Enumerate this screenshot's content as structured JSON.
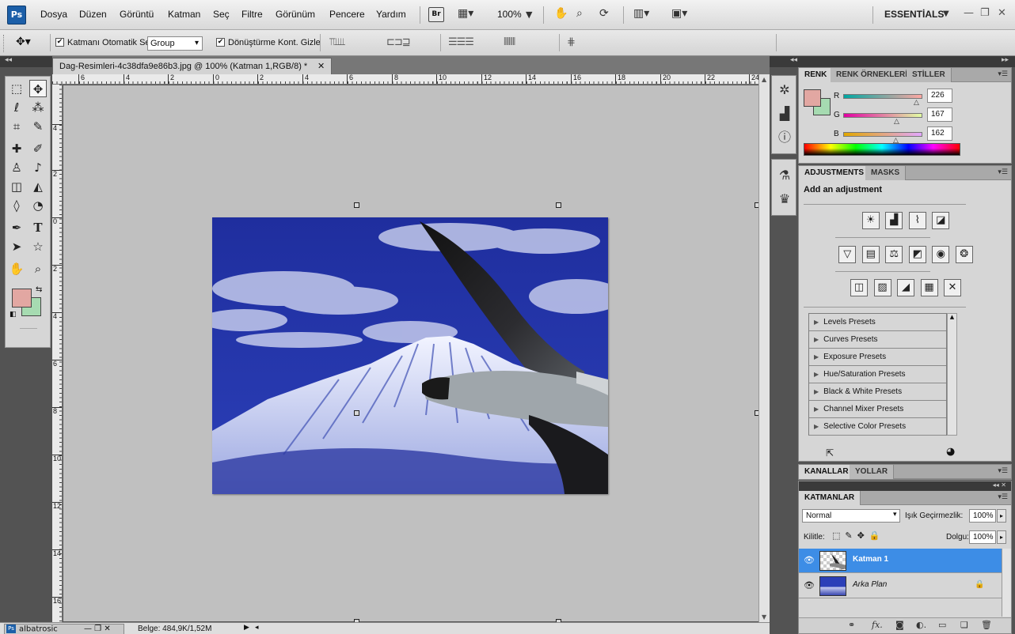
{
  "app": {
    "logo": "Ps",
    "workspace": "ESSENTİALS",
    "bridge": "Br",
    "zoom": "100%"
  },
  "menu": [
    "Dosya",
    "Düzen",
    "Görüntü",
    "Katman",
    "Seç",
    "Filtre",
    "Görünüm",
    "Pencere",
    "Yardım"
  ],
  "options": {
    "auto_select_label": "Katmanı Otomatik Seç",
    "auto_select_value": "Group",
    "transform_label": "Dönüştürme Kont. Gizle"
  },
  "document": {
    "tab_title": "Dag-Resimleri-4c38dfa9e86b3.jpg @ 100% (Katman 1,RGB/8) *",
    "status": "Belge: 484,9K/1,52M",
    "minimized": "albatrosic"
  },
  "ruler_top": [
    "6",
    "4",
    "2",
    "0",
    "2",
    "4",
    "6",
    "8",
    "10",
    "12",
    "14",
    "16",
    "18",
    "20",
    "22",
    "24"
  ],
  "ruler_left": [
    "4",
    "2",
    "0",
    "2",
    "4",
    "6",
    "8",
    "10",
    "12",
    "14",
    "16"
  ],
  "color_panel": {
    "tabs": [
      "RENK",
      "RENK ÖRNEKLERİ",
      "STİLLER"
    ],
    "r_label": "R",
    "g_label": "G",
    "b_label": "B",
    "r": "226",
    "g": "167",
    "b": "162",
    "fg_color": "#e2a7a2",
    "bg_color": "#a6dbb1"
  },
  "adjustments": {
    "tabs": [
      "ADJUSTMENTS",
      "MASKS"
    ],
    "title": "Add an adjustment",
    "presets": [
      "Levels Presets",
      "Curves Presets",
      "Exposure Presets",
      "Hue/Saturation Presets",
      "Black & White Presets",
      "Channel Mixer Presets",
      "Selective Color Presets"
    ]
  },
  "channels": {
    "tabs": [
      "KANALLAR",
      "YOLLAR"
    ]
  },
  "layers": {
    "tab": "KATMANLAR",
    "blend_mode": "Normal",
    "opacity_label": "Işık Geçirmezlik:",
    "opacity": "100%",
    "lock_label": "Kilitle:",
    "fill_label": "Dolgu:",
    "fill": "100%",
    "items": [
      {
        "name": "Katman 1",
        "selected": true
      },
      {
        "name": "Arka Plan",
        "selected": false
      }
    ]
  }
}
